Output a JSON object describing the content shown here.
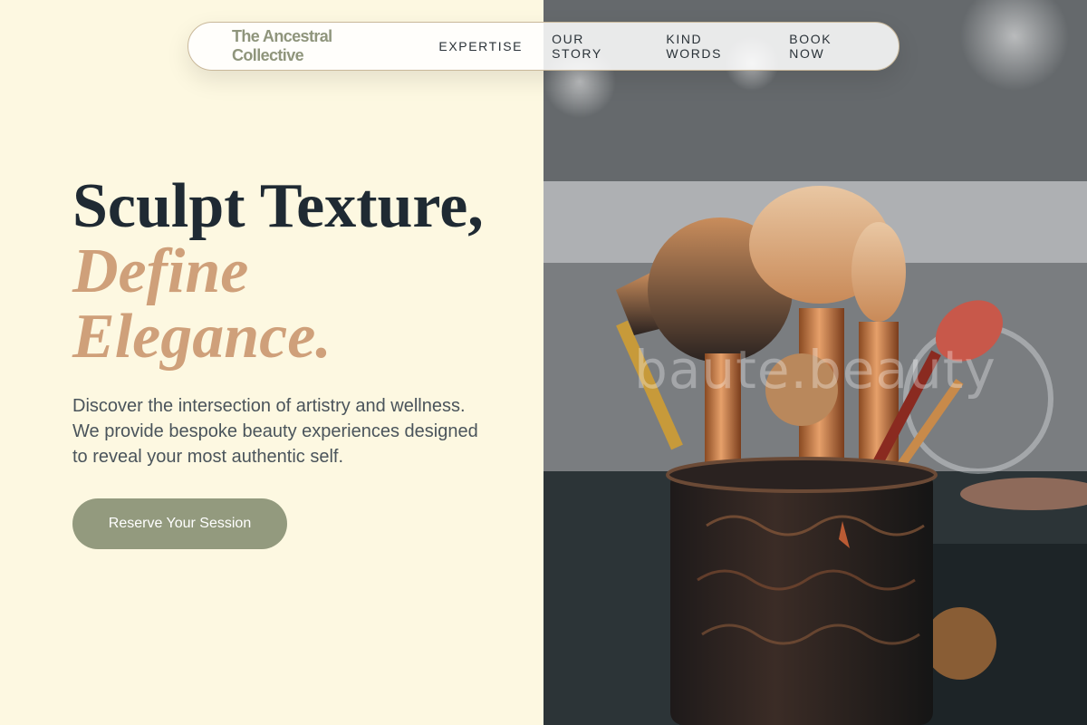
{
  "nav": {
    "brand": "The Ancestral Collective",
    "links": [
      "EXPERTISE",
      "OUR STORY",
      "KIND WORDS",
      "BOOK NOW"
    ]
  },
  "hero": {
    "title_line1": "Sculpt Texture,",
    "title_accent_line1": "Define",
    "title_accent_line2": "Elegance.",
    "description": "Discover the intersection of artistry and wellness. We provide bespoke beauty experiences designed to reveal your most authentic self.",
    "cta_label": "Reserve Your Session"
  },
  "photo": {
    "watermark": "baute.beauty",
    "subject": "makeup-brushes-in-cup"
  },
  "colors": {
    "background": "#fdf8e1",
    "heading": "#1f2a33",
    "accent": "#cfa07a",
    "brand": "#8f957c",
    "button": "#939a7e",
    "body_text": "#4a545b"
  }
}
